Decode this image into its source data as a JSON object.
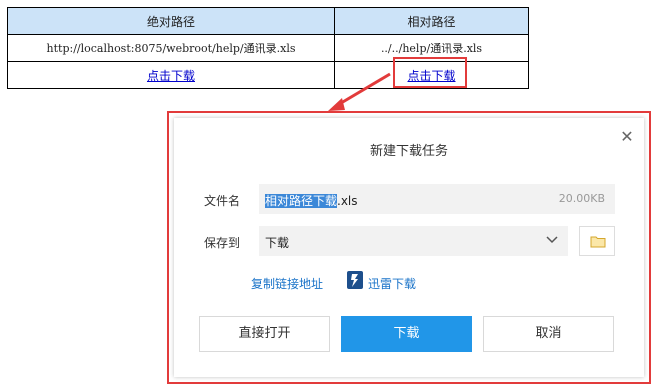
{
  "table": {
    "headers": [
      "绝对路径",
      "相对路径"
    ],
    "rows": [
      [
        "http://localhost:8075/webroot/help/通讯录.xls",
        "../../help/通讯录.xls"
      ],
      [
        "点击下载",
        "点击下载"
      ]
    ]
  },
  "dialog": {
    "title": "新建下载任务",
    "close_icon": "close-icon",
    "filename_label": "文件名",
    "filename_selected": "相对路径下载",
    "filename_ext": ".xls",
    "filesize": "20.00KB",
    "savedir_label": "保存到",
    "savedir_value": "下载",
    "copy_link": "复制链接地址",
    "thunder_download": "迅雷下载",
    "btn_open": "直接打开",
    "btn_download": "下载",
    "btn_cancel": "取消"
  },
  "colors": {
    "highlight": "#e23b3b",
    "header_bg": "#cce3f8",
    "primary": "#2196e8",
    "link": "#1a73c8"
  }
}
